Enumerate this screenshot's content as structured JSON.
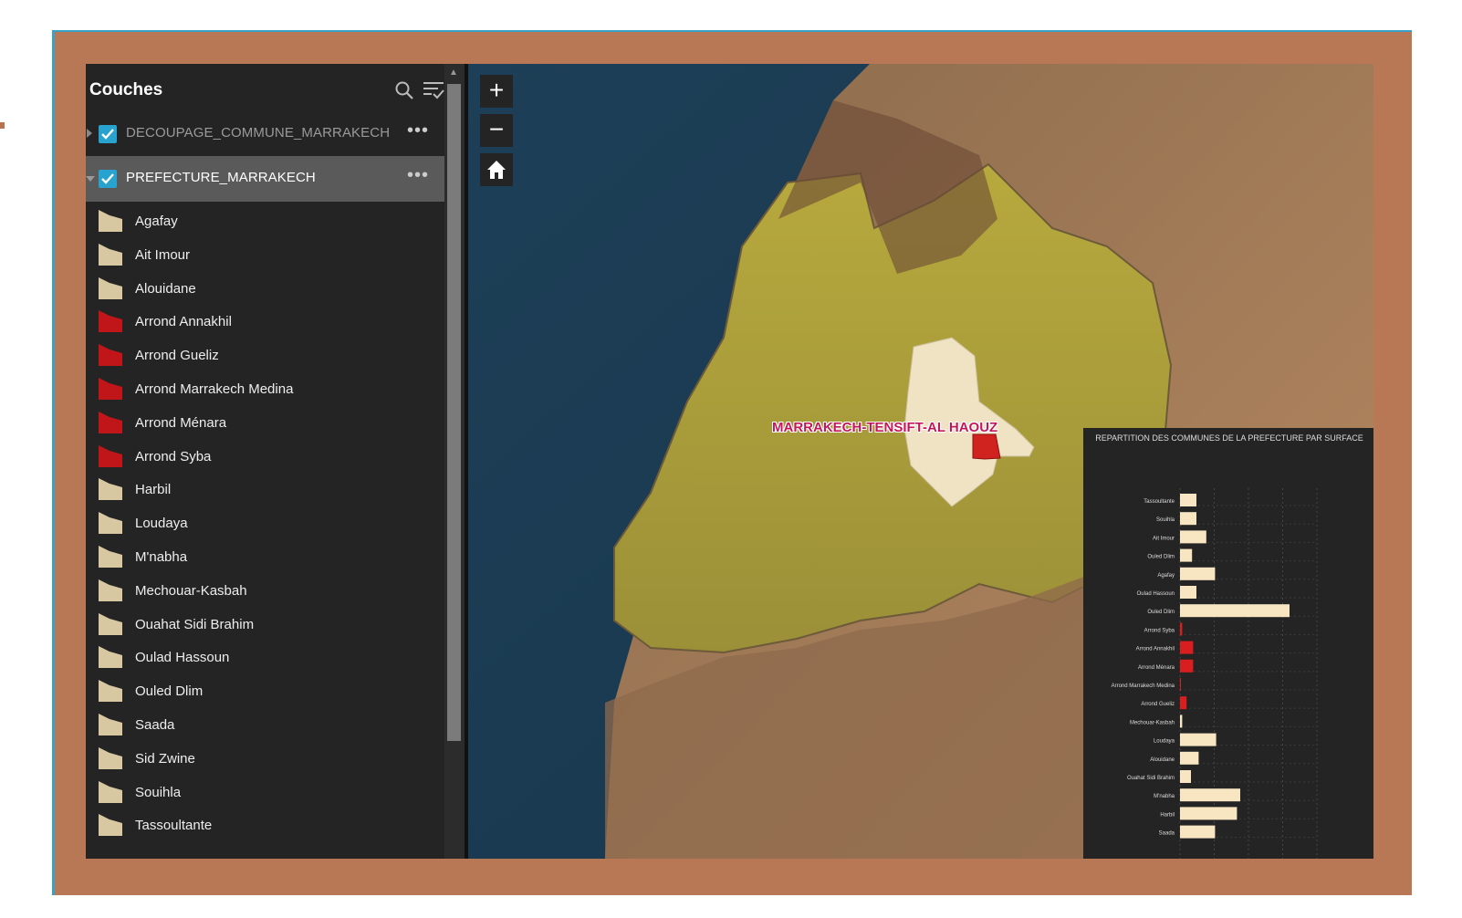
{
  "panel": {
    "title": "Couches",
    "layers": [
      {
        "name": "DECOUPAGE_COMMUNE_MARRAKECH",
        "menu": "•••"
      },
      {
        "name": "PREFECTURE_MARRAKECH",
        "menu": "•••"
      }
    ],
    "legend": [
      {
        "label": "Agafay",
        "color": "#d8c8a2"
      },
      {
        "label": "Ait Imour",
        "color": "#d8c8a2"
      },
      {
        "label": "Alouidane",
        "color": "#d8c8a2"
      },
      {
        "label": "Arrond Annakhil",
        "color": "#c0161a"
      },
      {
        "label": "Arrond Gueliz",
        "color": "#c0161a"
      },
      {
        "label": "Arrond Marrakech Medina",
        "color": "#c0161a"
      },
      {
        "label": "Arrond Ménara",
        "color": "#c0161a"
      },
      {
        "label": "Arrond Syba",
        "color": "#c0161a"
      },
      {
        "label": "Harbil",
        "color": "#d8c8a2"
      },
      {
        "label": "Loudaya",
        "color": "#d8c8a2"
      },
      {
        "label": "M'nabha",
        "color": "#d8c8a2"
      },
      {
        "label": "Mechouar-Kasbah",
        "color": "#d8c8a2"
      },
      {
        "label": "Ouahat Sidi Brahim",
        "color": "#d8c8a2"
      },
      {
        "label": "Oulad Hassoun",
        "color": "#d8c8a2"
      },
      {
        "label": "Ouled Dlim",
        "color": "#d8c8a2"
      },
      {
        "label": "Saada",
        "color": "#d8c8a2"
      },
      {
        "label": "Sid Zwine",
        "color": "#d8c8a2"
      },
      {
        "label": "Souihla",
        "color": "#d8c8a2"
      },
      {
        "label": "Tassoultante",
        "color": "#d8c8a2"
      }
    ]
  },
  "map": {
    "zoom_in": "+",
    "zoom_out": "−",
    "region_label": "MARRAKECH-TENSIFT-AL HAOUZ"
  },
  "chart_data": {
    "type": "bar",
    "orientation": "horizontal",
    "title": "REPARTITION DES COMMUNES DE LA PREFECTURE PAR SURFACE",
    "categories": [
      "Tassoultante",
      "Souihla",
      "Ait Imour",
      "Ouled Dlim",
      "Agafay",
      "Oulad Hassoun",
      "Ouled Dlim",
      "Arrond Syba",
      "Arrond Annakhil",
      "Arrond Ménara",
      "Arrond Marrakech Medina",
      "Arrond Gueliz",
      "Mechouar-Kasbah",
      "Loudaya",
      "Alouidane",
      "Ouahat Sidi Brahim",
      "M'nabha",
      "Harbil",
      "Saada"
    ],
    "values": [
      15,
      15,
      24,
      11,
      32,
      15,
      100,
      2,
      12,
      12,
      0.5,
      6,
      2,
      33,
      17,
      10,
      55,
      52,
      32
    ],
    "colors": [
      "#f8e6c2",
      "#f8e6c2",
      "#f8e6c2",
      "#f8e6c2",
      "#f8e6c2",
      "#f8e6c2",
      "#f8e6c2",
      "#d81e1e",
      "#d81e1e",
      "#d81e1e",
      "#d81e1e",
      "#d81e1e",
      "#f8e6c2",
      "#f8e6c2",
      "#f8e6c2",
      "#f8e6c2",
      "#f8e6c2",
      "#f8e6c2",
      "#f8e6c2"
    ],
    "xlim": [
      0,
      125
    ],
    "grid": true
  }
}
